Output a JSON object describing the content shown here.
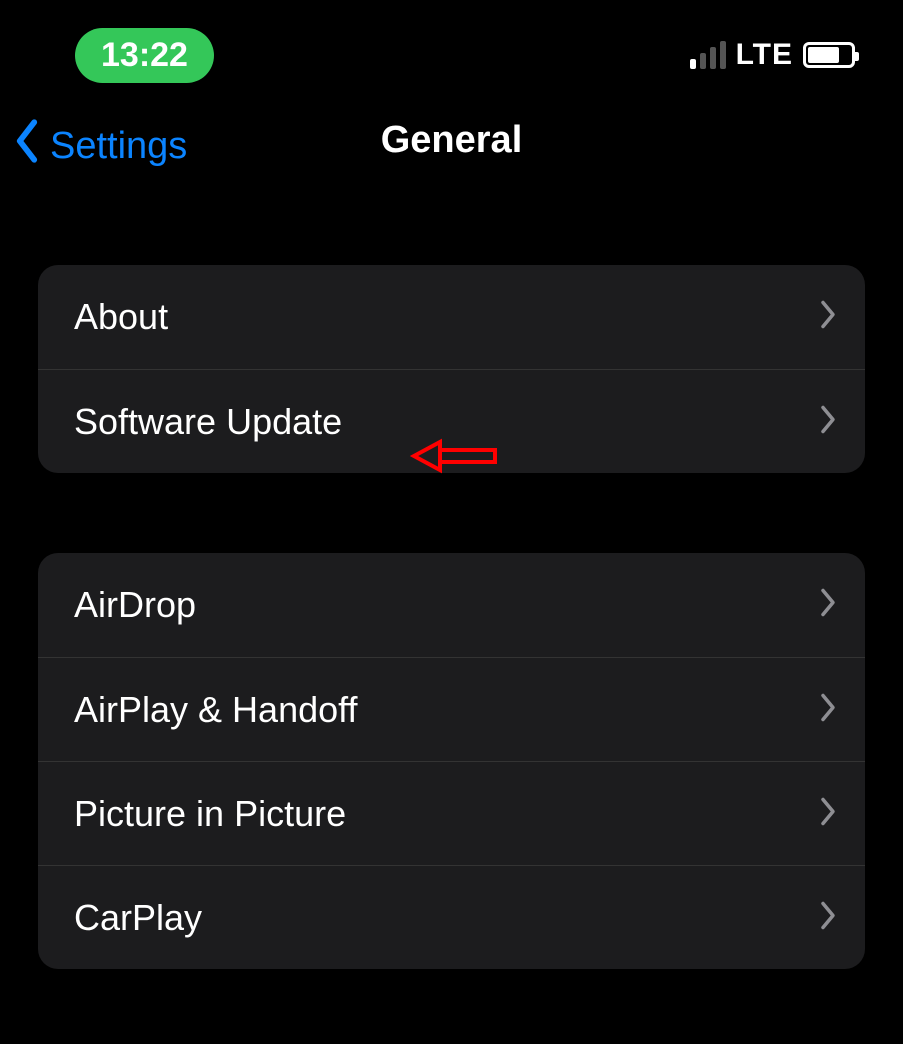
{
  "status": {
    "time": "13:22",
    "network_label": "LTE",
    "signal_active_bars": 1,
    "battery_pct": 70
  },
  "nav": {
    "back_label": "Settings",
    "title": "General"
  },
  "groups": [
    {
      "rows": [
        {
          "label": "About"
        },
        {
          "label": "Software Update"
        }
      ]
    },
    {
      "rows": [
        {
          "label": "AirDrop"
        },
        {
          "label": "AirPlay & Handoff"
        },
        {
          "label": "Picture in Picture"
        },
        {
          "label": "CarPlay"
        }
      ]
    }
  ],
  "annotation": {
    "target_row_label": "Software Update",
    "color": "#ff0000"
  }
}
